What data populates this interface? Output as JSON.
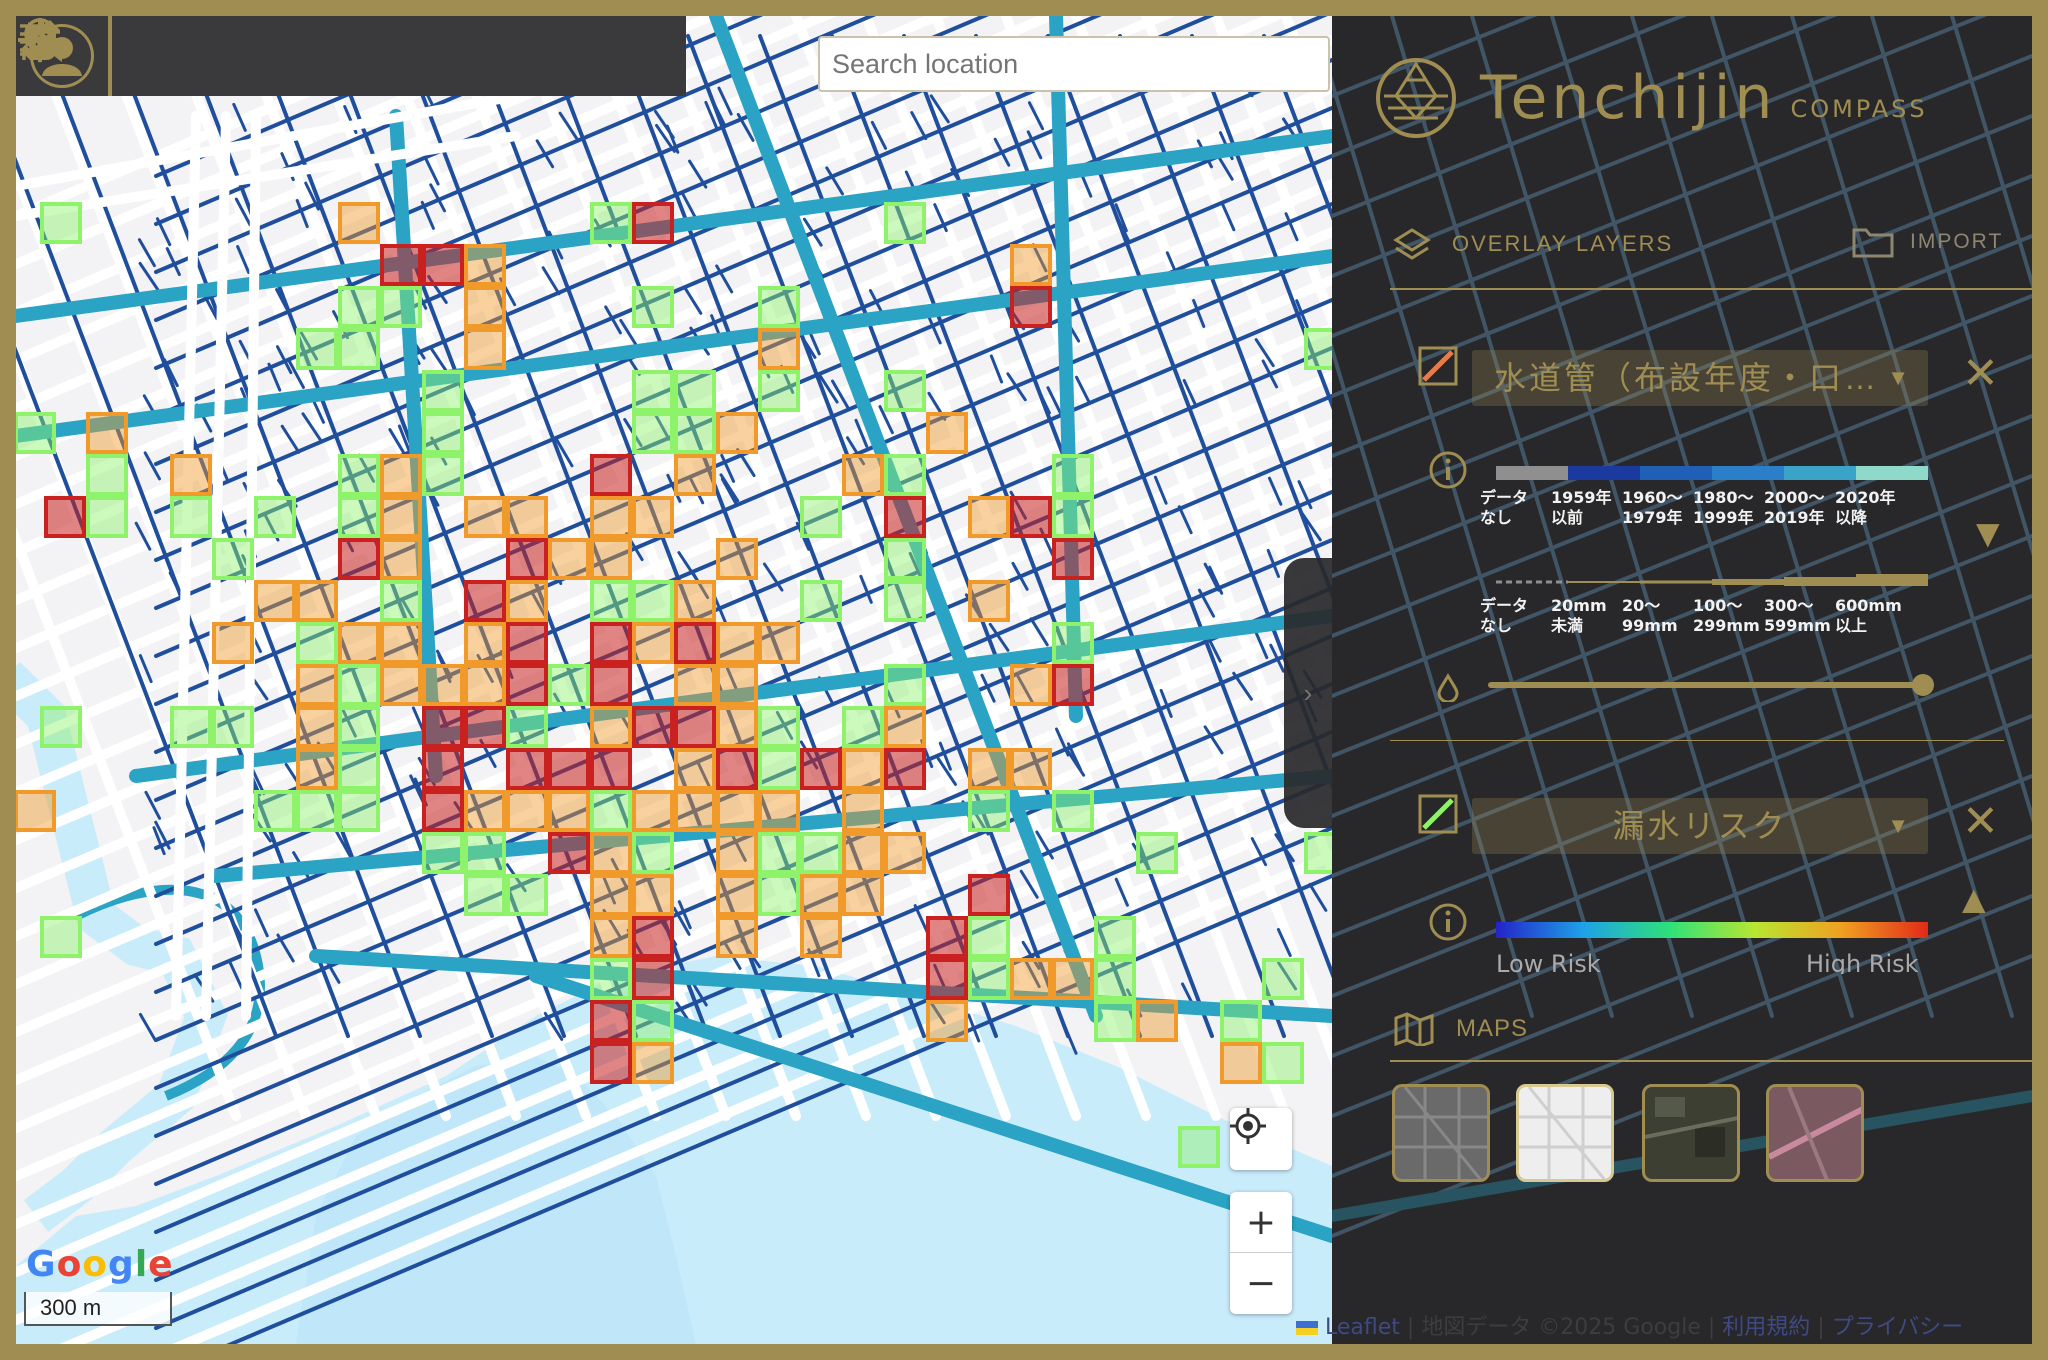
{
  "toolbar": {
    "tools": [
      {
        "name": "hand-pan-icon"
      },
      {
        "name": "pointer-select-icon"
      },
      {
        "name": "area-select-icon"
      },
      {
        "name": "ruler-measure-icon"
      },
      {
        "name": "location-pin-icon"
      },
      {
        "name": "search-list-icon"
      },
      {
        "name": "pipe-leak-icon"
      }
    ]
  },
  "search": {
    "placeholder": "Search location"
  },
  "map": {
    "google_logo": "Google",
    "scale_label": "300 m",
    "zoom_in": "+",
    "zoom_out": "−"
  },
  "brand": {
    "name": "Tenchijin",
    "sub": "COMPASS"
  },
  "panel": {
    "overlay_header": "OVERLAY LAYERS",
    "import_label": "IMPORT",
    "layer1": {
      "select_label": "水道管（布設年度・口…",
      "years": [
        {
          "l1": "データ",
          "l2": "なし"
        },
        {
          "l1": "1959年",
          "l2": "以前"
        },
        {
          "l1": "1960～",
          "l2": "1979年"
        },
        {
          "l1": "1980～",
          "l2": "1999年"
        },
        {
          "l1": "2000～",
          "l2": "2019年"
        },
        {
          "l1": "2020年",
          "l2": "以降"
        }
      ],
      "diameters": [
        {
          "l1": "データ",
          "l2": "なし"
        },
        {
          "l1": "20mm",
          "l2": "未満"
        },
        {
          "l1": "20～",
          "l2": "99mm"
        },
        {
          "l1": "100～",
          "l2": "299mm"
        },
        {
          "l1": "300～",
          "l2": "599mm"
        },
        {
          "l1": "600mm",
          "l2": "以上"
        }
      ],
      "opacity": 1.0
    },
    "layer2": {
      "select_label": "漏水リスク",
      "low": "Low Risk",
      "high": "High Risk"
    },
    "maps_header": "MAPS"
  },
  "attribution": {
    "leaflet": "Leaflet",
    "data": "地図データ ©2025 Google",
    "terms": "利用規約",
    "privacy": "プライバシー"
  },
  "colors": {
    "gold": "#a08d52",
    "panel_bg": "#2d2d2f",
    "risk_high": "#c8211f",
    "risk_mid": "#ef9a2a",
    "risk_low": "#8ef26a",
    "pipe_dark": "#1f4f9c",
    "pipe_teal": "#2aa3c4",
    "sea": "#c9ecfb"
  }
}
